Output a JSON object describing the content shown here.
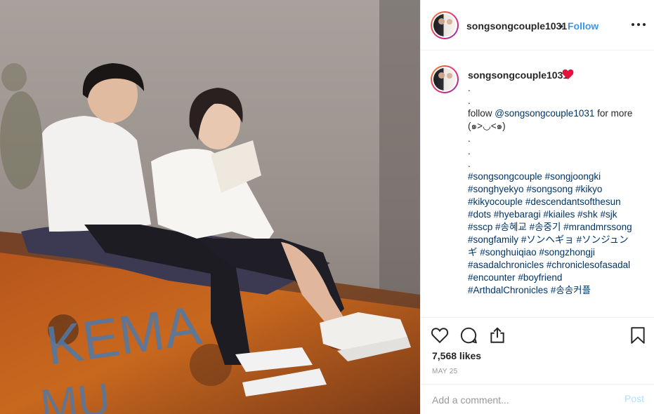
{
  "post": {
    "header": {
      "username": "songsongcouple1031",
      "separator": "•",
      "follow_label": "Follow"
    },
    "caption": {
      "username": "songsongcouple1031",
      "lines": [
        ".",
        ".",
        "follow @songsongcouple1031 for more (๑>◡<๑)",
        ".",
        ".",
        ".",
        "#songsongcouple #songjoongki #songhyekyo #songsong #kikyo #kikyocouple #descendantsofthesun #dots #hyebaragi #kiailes #shk #sjk #sscp #송혜교 #송중기 #mrandmrssong #songfamily #ソンヘギョ #ソンジュンギ #songhuiqiao #songzhongji #asadalchronicles #chroniclesofasadal #encounter #boyfriend #ArthdalChronicles #송송커플"
      ]
    },
    "likes": "7,568 likes",
    "date": "MAY 25",
    "comment_placeholder": "Add a comment...",
    "post_label": "Post",
    "photo_graffiti": [
      "KEMA",
      "MU"
    ]
  },
  "icons": [
    "heart-outline-icon",
    "comment-icon",
    "share-icon",
    "bookmark-icon",
    "more-options-icon",
    "red-heart-emoji-icon"
  ],
  "colors": {
    "follow": "#3897f0",
    "hashtag": "#003569",
    "post_disabled": "#b2dffc",
    "heart_emoji": "#e0143c"
  }
}
